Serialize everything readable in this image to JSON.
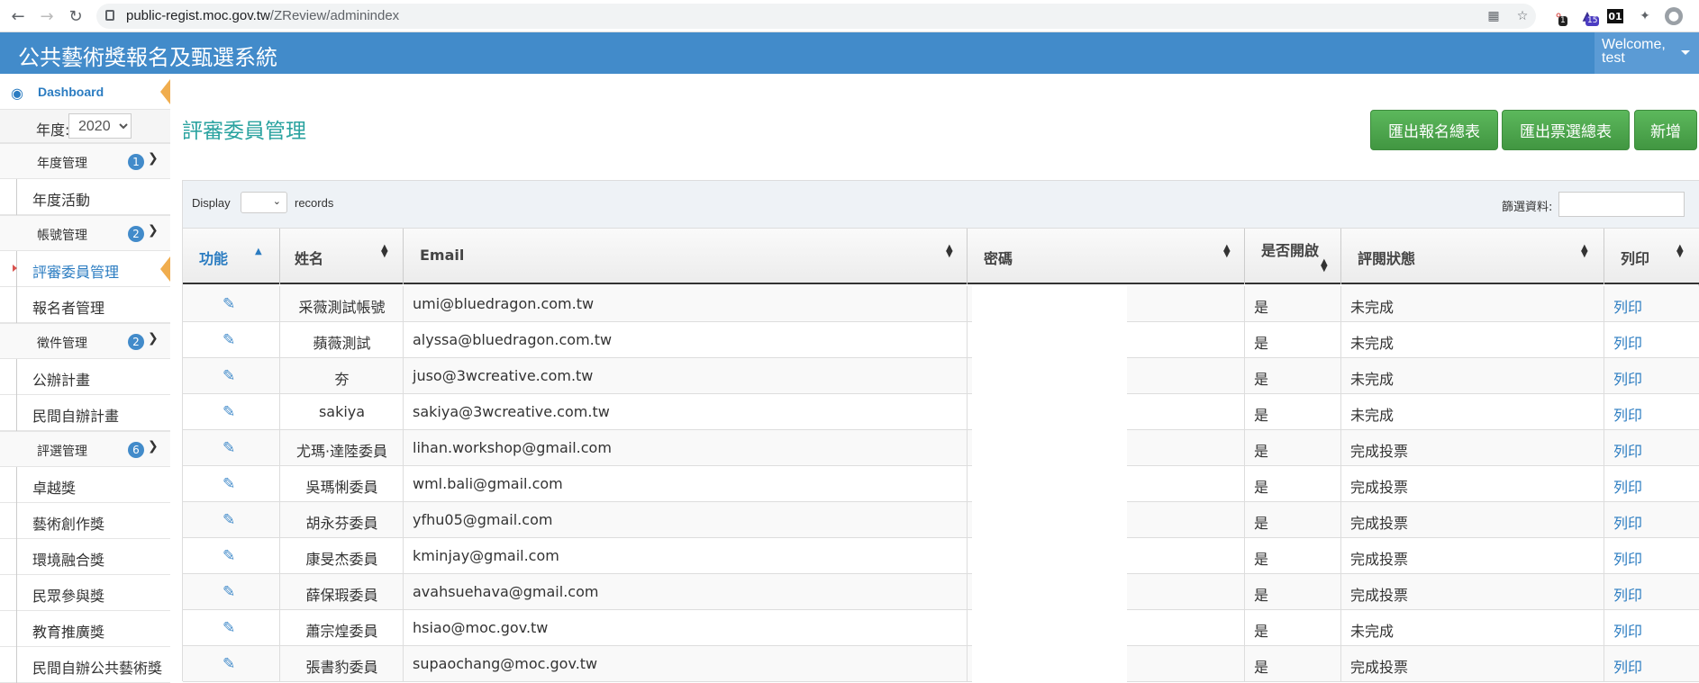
{
  "browser": {
    "url_host": "public-regist.moc.gov.tw",
    "url_path": "/ZReview/adminindex",
    "ext_badge_1": "1",
    "ext_badge_2": "15",
    "ext_label_3": "01"
  },
  "header": {
    "title": "公共藝術獎報名及甄選系統",
    "welcome_line1": "Welcome,",
    "welcome_line2": "test"
  },
  "sidebar": {
    "dashboard_label": "Dashboard",
    "year_label": "年度:",
    "year_value": "2020",
    "groups": [
      {
        "label": "年度管理",
        "count": "1"
      },
      {
        "label": "帳號管理",
        "count": "2"
      },
      {
        "label": "徵件管理",
        "count": "2"
      },
      {
        "label": "評選管理",
        "count": "6"
      }
    ],
    "items": [
      "年度活動",
      "評審委員管理",
      "報名者管理",
      "公辦計畫",
      "民間自辦計畫",
      "卓越獎",
      "藝術創作獎",
      "環境融合獎",
      "民眾參與獎",
      "教育推廣獎",
      "民間自辦公共藝術獎"
    ]
  },
  "main": {
    "page_title": "評審委員管理",
    "buttons": {
      "export_registration": "匯出報名總表",
      "export_votes": "匯出票選總表",
      "add": "新增"
    },
    "display_label": "Display",
    "records_label": "records",
    "filter_label": "篩選資料:",
    "columns": [
      "功能",
      "姓名",
      "Email",
      "密碼",
      "是否開啟",
      "評閱狀態",
      "列印"
    ],
    "rows": [
      {
        "name": "采薇測試帳號",
        "email": "umi@bluedragon.com.tw",
        "enabled": "是",
        "status": "未完成",
        "print": "列印"
      },
      {
        "name": "蘋薇測試",
        "email": "alyssa@bluedragon.com.tw",
        "enabled": "是",
        "status": "未完成",
        "print": "列印"
      },
      {
        "name": "夯",
        "email": "juso@3wcreative.com.tw",
        "enabled": "是",
        "status": "未完成",
        "print": "列印"
      },
      {
        "name": "sakiya",
        "email": "sakiya@3wcreative.com.tw",
        "enabled": "是",
        "status": "未完成",
        "print": "列印"
      },
      {
        "name": "尤瑪·達陸委員",
        "email": "lihan.workshop@gmail.com",
        "enabled": "是",
        "status": "完成投票",
        "print": "列印"
      },
      {
        "name": "吳瑪悧委員",
        "email": "wml.bali@gmail.com",
        "enabled": "是",
        "status": "完成投票",
        "print": "列印"
      },
      {
        "name": "胡永芬委員",
        "email": "yfhu05@gmail.com",
        "enabled": "是",
        "status": "完成投票",
        "print": "列印"
      },
      {
        "name": "康旻杰委員",
        "email": "kminjay@gmail.com",
        "enabled": "是",
        "status": "完成投票",
        "print": "列印"
      },
      {
        "name": "薛保瑕委員",
        "email": "avahsuehava@gmail.com",
        "enabled": "是",
        "status": "完成投票",
        "print": "列印"
      },
      {
        "name": "蕭宗煌委員",
        "email": "hsiao@moc.gov.tw",
        "enabled": "是",
        "status": "未完成",
        "print": "列印"
      },
      {
        "name": "張書豹委員",
        "email": "supaochang@moc.gov.tw",
        "enabled": "是",
        "status": "完成投票",
        "print": "列印"
      }
    ]
  },
  "colors": {
    "header": "#428bca",
    "title": "#2ba3a0",
    "button": "#5cb85c",
    "link": "#2b7cc1",
    "active_marker": "#f0ad4e"
  }
}
